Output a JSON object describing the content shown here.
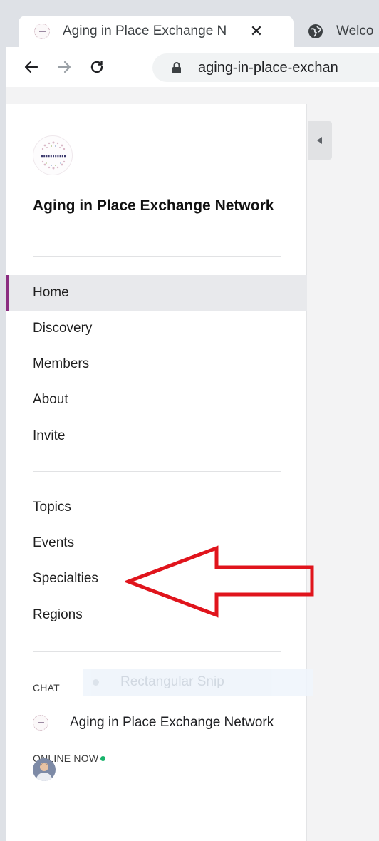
{
  "browser": {
    "active_tab_title": "Aging in Place Exchange N",
    "inactive_tab_title": "Welco",
    "url": "aging-in-place-exchan"
  },
  "brand": {
    "logo_text": "A.I.P.E.N.",
    "network_name": "Aging in Place Exchange Network",
    "accent_color": "#8b2d80"
  },
  "nav_primary": [
    {
      "label": "Home",
      "active": true
    },
    {
      "label": "Discovery"
    },
    {
      "label": "Members"
    },
    {
      "label": "About"
    },
    {
      "label": "Invite"
    }
  ],
  "nav_secondary": [
    {
      "label": "Topics"
    },
    {
      "label": "Events"
    },
    {
      "label": "Specialties"
    },
    {
      "label": "Regions"
    }
  ],
  "chat": {
    "section_label": "CHAT",
    "channel_name": "Aging in Place Exchange Network"
  },
  "online": {
    "label": "ONLINE NOW",
    "status_color": "#19b36b"
  },
  "overlay": {
    "snip_label": "Rectangular Snip"
  },
  "annotation": {
    "arrow_color": "#e0141c",
    "points_to": "Specialties"
  },
  "icons": {
    "back": "arrow-left-icon",
    "forward": "arrow-right-icon",
    "reload": "reload-icon",
    "secure": "lock-icon",
    "tab_close": "close-icon",
    "tab_globe": "globe-icon",
    "sidebar_toggle": "caret-left-icon"
  }
}
